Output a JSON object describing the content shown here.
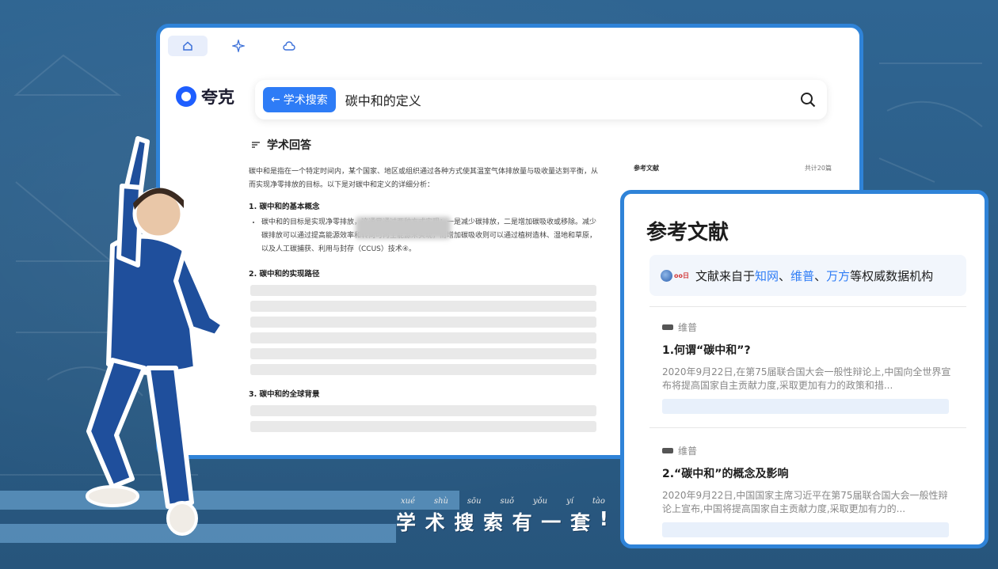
{
  "brand": {
    "name": "夸克"
  },
  "tabs": [
    {
      "icon": "home-icon",
      "active": true
    },
    {
      "icon": "sparkle-icon",
      "active": false
    },
    {
      "icon": "cloud-icon",
      "active": false
    }
  ],
  "search": {
    "chip_label": "学术搜索",
    "query": "碳中和的定义"
  },
  "answer": {
    "heading": "学术回答",
    "intro": "碳中和是指在一个特定时间内，某个国家、地区或组织通过各种方式使其温室气体排放量与吸收量达到平衡，从而实现净零排放的目标。以下是对碳中和定义的详细分析：",
    "section1_title": "1. 碳中和的基本概念",
    "section1_bullet": "碳中和的目标是实现净零排放，这通常通过两种方式实现：一是减少碳排放，二是增加碳吸收或移除。减少碳排放可以通过提高能源效率和转向可再生能源来实现，而增加碳吸收则可以通过植树造林、湿地和草原，以及人工碳捕获、利用与封存（CCUS）技术④。",
    "section2_title": "2. 碳中和的实现路径",
    "section3_title": "3. 碳中和的全球背景"
  },
  "ref_mini": {
    "label": "参考文献",
    "count": "共计20篇"
  },
  "references": {
    "title": "参考文献",
    "source_prefix": "文献来自于",
    "source_zhiwang": "知网",
    "source_sep1": "、",
    "source_weipu": "维普",
    "source_sep2": "、",
    "source_wanfang": "万方",
    "source_suffix": "等权威数据机构",
    "items": [
      {
        "source": "维普",
        "title": "1.何谓“碳中和”?",
        "snippet": "2020年9月22日,在第75届联合国大会一般性辩论上,中国向全世界宣布将提高国家自主贡献力度,采取更加有力的政策和措..."
      },
      {
        "source": "维普",
        "title": "2.“碳中和”的概念及影响",
        "snippet": "2020年9月22日,中国国家主席习近平在第75届联合国大会一般性辩论上宣布,中国将提高国家自主贡献力度,采取更加有力的..."
      }
    ]
  },
  "slogan": {
    "pinyin": [
      "xué",
      "shù",
      "sōu",
      "suǒ",
      "yǒu",
      "yí",
      "tào"
    ],
    "chars": [
      "学",
      "术",
      "搜",
      "索",
      "有",
      "一",
      "套",
      "!"
    ]
  },
  "colors": {
    "accent": "#2e7cf6",
    "frame": "#2f83d8",
    "background": "#2d5f8a",
    "tracksuit": "#1f4f9c"
  }
}
